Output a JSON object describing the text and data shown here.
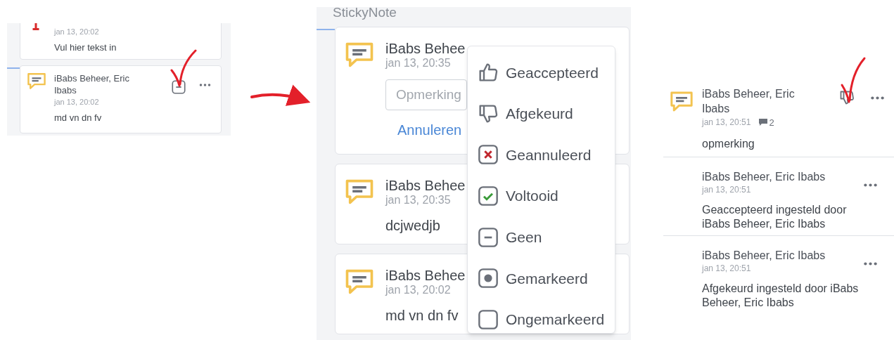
{
  "before": {
    "cards": [
      {
        "kind": "flag",
        "date": "jan 13, 20:02",
        "text": "Vul hier tekst in"
      },
      {
        "kind": "comment",
        "author": "iBabs Beheer, Eric Ibabs",
        "date": "jan 13, 20:02",
        "text": "md vn dn fv",
        "status": {
          "kind": "none"
        }
      }
    ]
  },
  "during": {
    "title": "StickyNote",
    "cards": [
      {
        "kind": "editing",
        "author": "iBabs Behee",
        "date": "jan 13, 20:35",
        "placeholder": "Opmerking",
        "cancel": "Annuleren"
      },
      {
        "kind": "comment",
        "author": "iBabs Behee",
        "date": "jan 13, 20:35",
        "text": "dcjwedjb"
      },
      {
        "kind": "comment",
        "author": "iBabs Behee",
        "date": "jan 13, 20:02",
        "text": "md vn dn fv"
      }
    ],
    "menu": [
      {
        "kind": "accepted",
        "label": "Geaccepteerd"
      },
      {
        "kind": "rejected",
        "label": "Afgekeurd"
      },
      {
        "kind": "cancelled",
        "label": "Geannuleerd"
      },
      {
        "kind": "done",
        "label": "Voltooid"
      },
      {
        "kind": "none",
        "label": "Geen"
      },
      {
        "kind": "marked",
        "label": "Gemarkeerd"
      },
      {
        "kind": "unmarked",
        "label": "Ongemarkeerd"
      }
    ]
  },
  "after": {
    "items": [
      {
        "kind": "note",
        "author": "iBabs Beheer, Eric Ibabs",
        "date": "jan 13, 20:51",
        "replies": "2",
        "text": "opmerking",
        "status": {
          "kind": "rejected"
        }
      },
      {
        "kind": "reply",
        "author": "iBabs Beheer, Eric Ibabs",
        "date": "jan 13, 20:51",
        "text": "Geaccepteerd ingesteld door iBabs Beheer, Eric Ibabs"
      },
      {
        "kind": "reply",
        "author": "iBabs Beheer, Eric Ibabs",
        "date": "jan 13, 20:51",
        "text": "Afgekeurd ingesteld door iBabs Beheer, Eric Ibabs"
      }
    ]
  }
}
